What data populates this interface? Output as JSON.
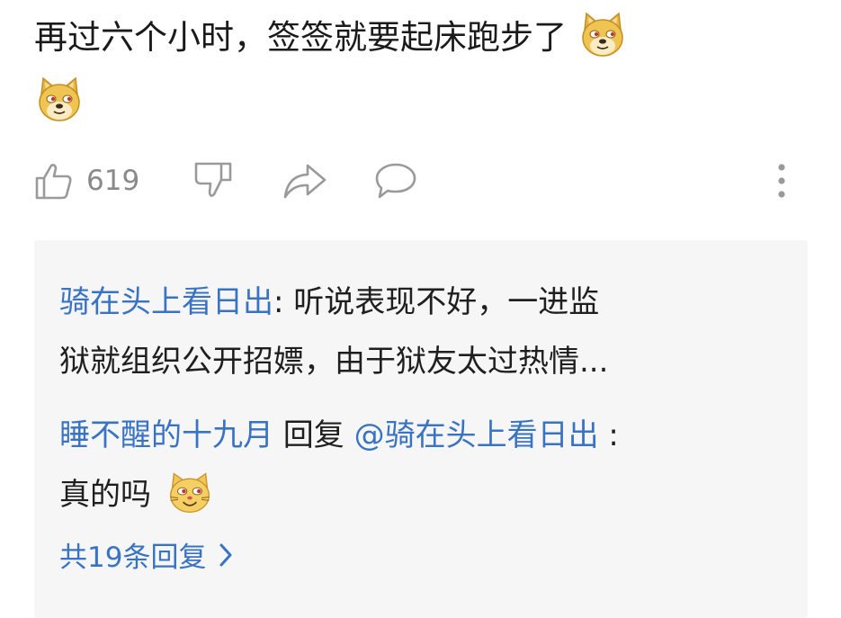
{
  "comment": {
    "text": "再过六个小时，签签就要起床跑步了",
    "emoji_icon": "doge-emoji-icon"
  },
  "actions": {
    "like_count": "619",
    "icons": [
      "thumbs-up-icon",
      "thumbs-down-icon",
      "share-icon",
      "comment-bubble-icon",
      "more-vertical-icon"
    ]
  },
  "replies": [
    {
      "user": "骑在头上看日出",
      "separator": ":",
      "text_line1": " 听说表现不好，一进监",
      "text_line2": "狱就组织公开招嫖，由于狱友太过热情..."
    },
    {
      "user": "睡不醒的十九月",
      "reply_word": " 回复 ",
      "mention": "@骑在头上看日出",
      "separator": " :",
      "text": "真的吗",
      "emoji_icon": "cat-emoji-icon"
    }
  ],
  "more_replies": "共19条回复",
  "colors": {
    "link_blue": "#3873c4",
    "icon_gray": "#9a9a9a",
    "reply_bg": "#f6f6f6"
  }
}
